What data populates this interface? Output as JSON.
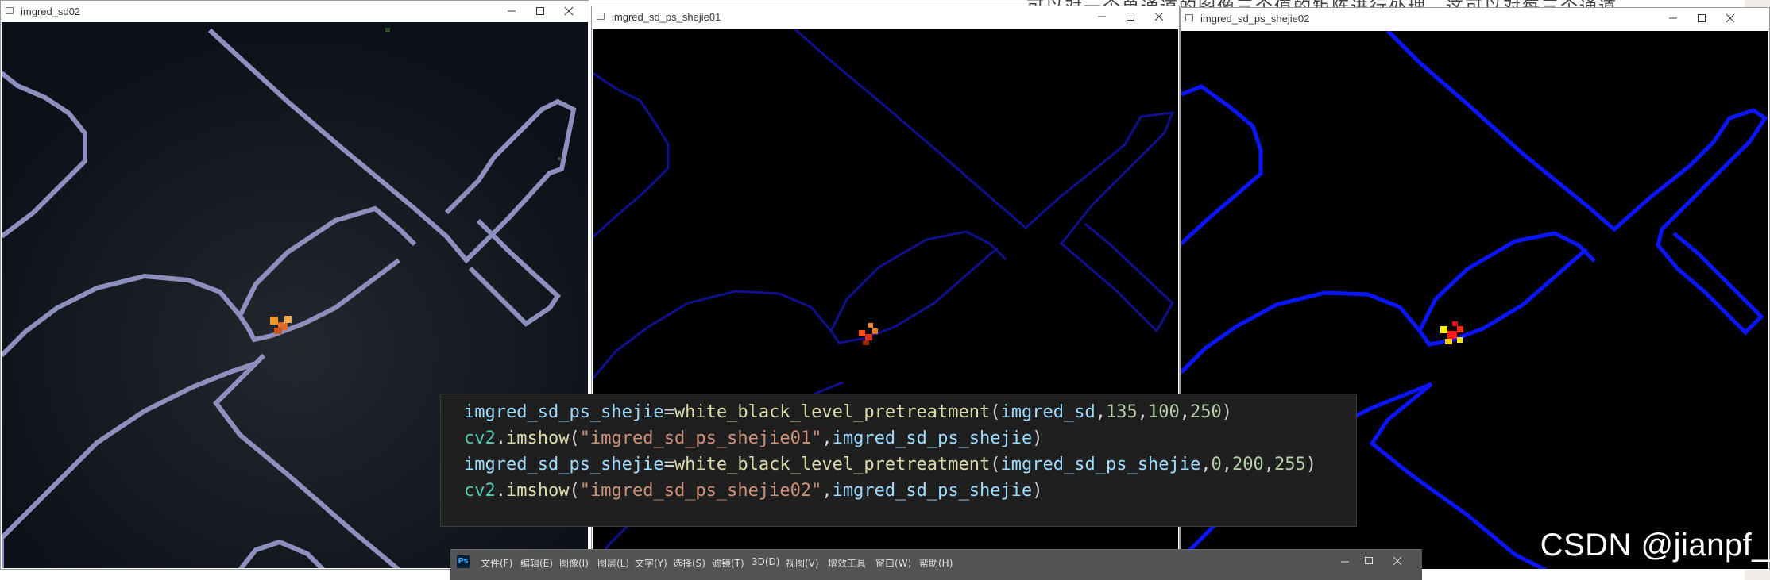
{
  "background": {
    "top_text": "可以对一个单通道的图像三个值的矩阵进行处理，这可以对每三个通道"
  },
  "windows": [
    {
      "title": "imgred_sd02",
      "background_color": "#10141c",
      "line_color": "#8f8fbf"
    },
    {
      "title": "imgred_sd_ps_shejie01",
      "background_color": "#000000",
      "line_color": "#10108e"
    },
    {
      "title": "imgred_sd_ps_shejie02",
      "background_color": "#000000",
      "line_color": "#0a14ff"
    }
  ],
  "code": {
    "lines": [
      "imgred_sd_ps_shejie=white_black_level_pretreatment(imgred_sd,135,100,250)",
      "cv2.imshow(\"imgred_sd_ps_shejie01\",imgred_sd_ps_shejie)",
      "imgred_sd_ps_shejie=white_black_level_pretreatment(imgred_sd_ps_shejie,0,200,255)",
      "cv2.imshow(\"imgred_sd_ps_shejie02\",imgred_sd_ps_shejie)"
    ]
  },
  "photoshop": {
    "logo": "Ps",
    "menu": [
      "文件(F)",
      "编辑(E)",
      "图像(I)",
      "图层(L)",
      "文字(Y)",
      "选择(S)",
      "滤镜(T)",
      "3D(D)",
      "视图(V)",
      "增效工具",
      "窗口(W)",
      "帮助(H)"
    ]
  },
  "watermark": "CSDN @jianpf_",
  "icons": {
    "minimize": "minimize-icon",
    "maximize": "maximize-icon",
    "close": "close-icon",
    "window_app": "window-app-icon"
  }
}
